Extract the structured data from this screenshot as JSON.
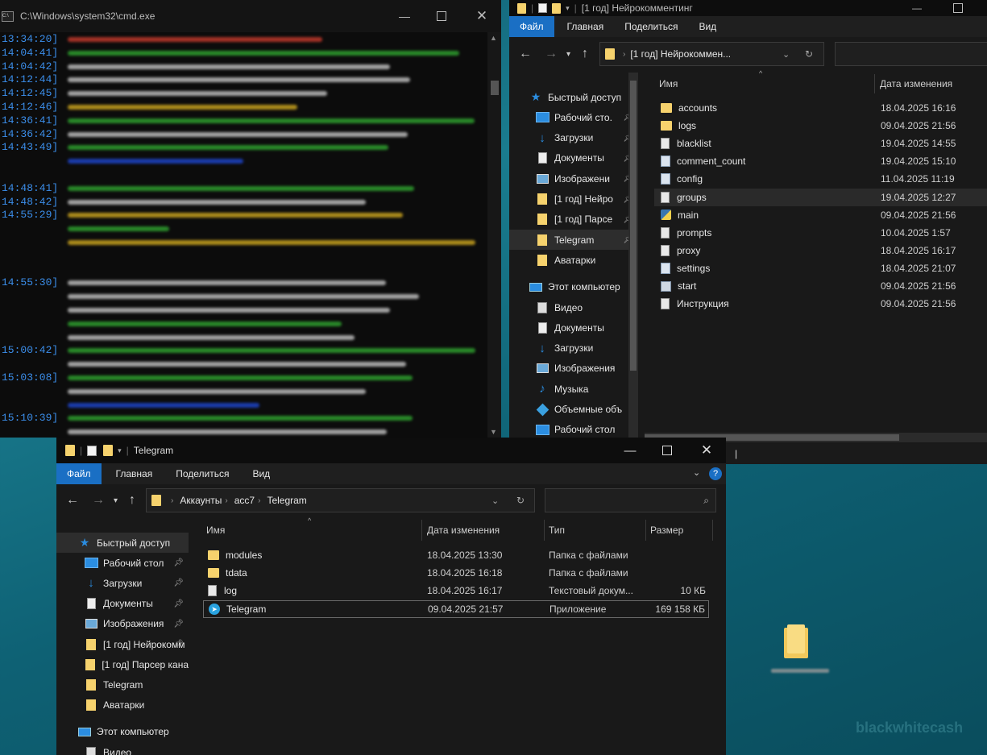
{
  "cmd": {
    "title": "C:\\Windows\\system32\\cmd.exe",
    "timestamps": [
      "13:34:20]",
      "14:04:41]",
      "14:04:42]",
      "14:12:44]",
      "14:12:45]",
      "14:12:46]",
      "14:36:41]",
      "14:36:42]",
      "14:43:49]",
      "14:48:41]",
      "14:48:42]",
      "14:55:29]",
      "14:55:30]",
      "15:00:42]",
      "15:03:08]",
      "15:10:39]"
    ],
    "colors": {
      "timestamp": "#3b8eea",
      "red": "#c0392b",
      "green": "#2e9e2e",
      "white": "#bdbdbd",
      "yellow": "#c8a21e",
      "blue": "#1d44c8"
    }
  },
  "explorer1": {
    "title": "[1 год] Нейрокомментинг",
    "tabs": [
      "Файл",
      "Главная",
      "Поделиться",
      "Вид"
    ],
    "address": "[1 год] Нейрокоммен...",
    "nav": {
      "quick_access": "Быстрый доступ",
      "items": [
        "Рабочий сто.",
        "Загрузки",
        "Документы",
        "Изображени",
        "[1 год] Нейро",
        "[1 год] Парсе",
        "Telegram",
        "Аватарки"
      ],
      "this_pc": "Этот компьютер",
      "pc_items": [
        "Видео",
        "Документы",
        "Загрузки",
        "Изображения",
        "Музыка",
        "Объемные объ",
        "Рабочий стол"
      ]
    },
    "columns": {
      "name": "Имя",
      "date": "Дата изменения"
    },
    "files": [
      {
        "name": "accounts",
        "date": "18.04.2025 16:16",
        "icon": "folder-icon"
      },
      {
        "name": "logs",
        "date": "09.04.2025 21:56",
        "icon": "folder-icon"
      },
      {
        "name": "blacklist",
        "date": "19.04.2025 14:55",
        "icon": "text-file-icon"
      },
      {
        "name": "comment_count",
        "date": "19.04.2025 15:10",
        "icon": "config-file-icon"
      },
      {
        "name": "config",
        "date": "11.04.2025 11:19",
        "icon": "config-file-icon"
      },
      {
        "name": "groups",
        "date": "19.04.2025 12:27",
        "icon": "text-file-icon"
      },
      {
        "name": "main",
        "date": "09.04.2025 21:56",
        "icon": "python-file-icon"
      },
      {
        "name": "prompts",
        "date": "10.04.2025 1:57",
        "icon": "text-file-icon"
      },
      {
        "name": "proxy",
        "date": "18.04.2025 16:17",
        "icon": "text-file-icon"
      },
      {
        "name": "settings",
        "date": "18.04.2025 21:07",
        "icon": "config-file-icon"
      },
      {
        "name": "start",
        "date": "09.04.2025 21:56",
        "icon": "batch-file-icon"
      },
      {
        "name": "Инструкция",
        "date": "09.04.2025 21:56",
        "icon": "text-file-icon"
      }
    ],
    "cursor_hint": "|"
  },
  "explorer2": {
    "title": "Telegram",
    "tabs": [
      "Файл",
      "Главная",
      "Поделиться",
      "Вид"
    ],
    "breadcrumb": [
      "Аккаунты",
      "acc7",
      "Telegram"
    ],
    "nav": {
      "quick_access": "Быстрый доступ",
      "items": [
        "Рабочий стол",
        "Загрузки",
        "Документы",
        "Изображения",
        "[1 год] Нейрокомм",
        "[1 год] Парсер кана",
        "Telegram",
        "Аватарки"
      ],
      "this_pc": "Этот компьютер",
      "pc_items": [
        "Видео"
      ]
    },
    "columns": {
      "name": "Имя",
      "date": "Дата изменения",
      "type": "Тип",
      "size": "Размер"
    },
    "files": [
      {
        "name": "modules",
        "date": "18.04.2025 13:30",
        "type": "Папка с файлами",
        "size": "",
        "icon": "folder-icon"
      },
      {
        "name": "tdata",
        "date": "18.04.2025 16:18",
        "type": "Папка с файлами",
        "size": "",
        "icon": "folder-icon"
      },
      {
        "name": "log",
        "date": "18.04.2025 16:17",
        "type": "Текстовый докум...",
        "size": "10 КБ",
        "icon": "text-file-icon"
      },
      {
        "name": "Telegram",
        "date": "09.04.2025 21:57",
        "type": "Приложение",
        "size": "169 158 КБ",
        "icon": "telegram-icon"
      }
    ]
  },
  "watermark": "blackwhitecash",
  "colors": {
    "accent": "#1a6fc4",
    "folder": "#f6d26d",
    "window_bg": "#191919"
  }
}
